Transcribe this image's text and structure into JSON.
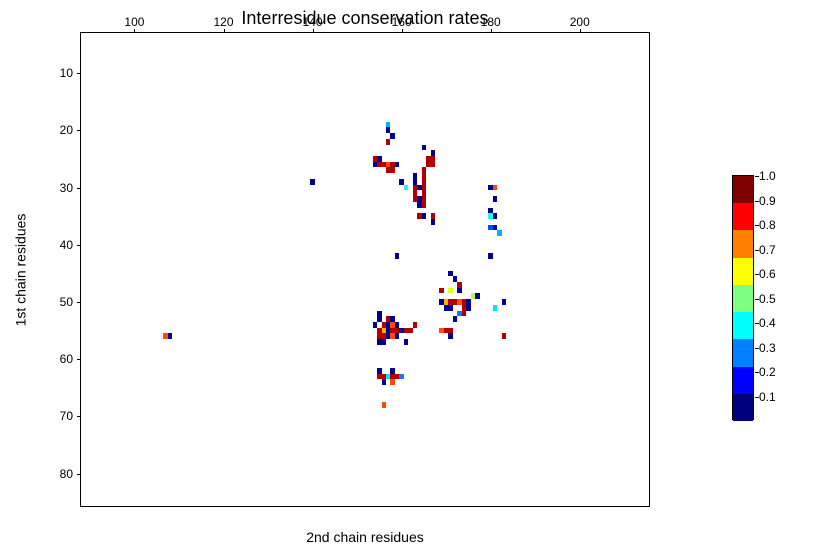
{
  "chart_data": {
    "type": "heatmap",
    "title": "Interresidue conservation rates",
    "xlabel": "2nd chain residues",
    "ylabel": "1st chain residues",
    "xlim": [
      88,
      216
    ],
    "ylim": [
      86,
      3
    ],
    "x_ticks": [
      100,
      120,
      140,
      160,
      180,
      200
    ],
    "y_ticks": [
      10,
      20,
      30,
      40,
      50,
      60,
      70,
      80
    ],
    "colorbar": {
      "ticks": [
        0.1,
        0.2,
        0.3,
        0.4,
        0.5,
        0.6,
        0.7,
        0.8,
        0.9,
        1.0
      ],
      "colors": [
        "#00007f",
        "#0000ff",
        "#007fff",
        "#00ffff",
        "#7fff7f",
        "#ffff00",
        "#ff7f00",
        "#ff0000",
        "#7f0000"
      ]
    },
    "points": [
      {
        "x": 157,
        "y": 19,
        "v": 0.3
      },
      {
        "x": 157,
        "y": 20,
        "v": 0.02
      },
      {
        "x": 158,
        "y": 21,
        "v": 0.02
      },
      {
        "x": 157,
        "y": 22,
        "v": 0.95
      },
      {
        "x": 165,
        "y": 23,
        "v": 0.02
      },
      {
        "x": 167,
        "y": 24,
        "v": 0.02
      },
      {
        "x": 154,
        "y": 25,
        "v": 0.95
      },
      {
        "x": 155,
        "y": 25,
        "v": 0.02
      },
      {
        "x": 166,
        "y": 25,
        "v": 0.95
      },
      {
        "x": 167,
        "y": 25,
        "v": 0.95
      },
      {
        "x": 154,
        "y": 26,
        "v": 0.02
      },
      {
        "x": 155,
        "y": 26,
        "v": 0.95
      },
      {
        "x": 156,
        "y": 26,
        "v": 0.95
      },
      {
        "x": 157,
        "y": 26,
        "v": 0.8
      },
      {
        "x": 158,
        "y": 26,
        "v": 0.95
      },
      {
        "x": 159,
        "y": 26,
        "v": 0.02
      },
      {
        "x": 166,
        "y": 26,
        "v": 0.95
      },
      {
        "x": 167,
        "y": 26,
        "v": 0.95
      },
      {
        "x": 157,
        "y": 27,
        "v": 0.95
      },
      {
        "x": 158,
        "y": 27,
        "v": 0.95
      },
      {
        "x": 165,
        "y": 27,
        "v": 0.95
      },
      {
        "x": 163,
        "y": 28,
        "v": 0.02
      },
      {
        "x": 165,
        "y": 28,
        "v": 0.95
      },
      {
        "x": 160,
        "y": 29,
        "v": 0.02
      },
      {
        "x": 163,
        "y": 29,
        "v": 0.02
      },
      {
        "x": 165,
        "y": 29,
        "v": 0.95
      },
      {
        "x": 140,
        "y": 29,
        "v": 0.02
      },
      {
        "x": 161,
        "y": 30,
        "v": 0.4
      },
      {
        "x": 163,
        "y": 30,
        "v": 0.95
      },
      {
        "x": 164,
        "y": 30,
        "v": 0.02
      },
      {
        "x": 165,
        "y": 30,
        "v": 0.95
      },
      {
        "x": 180,
        "y": 30,
        "v": 0.02
      },
      {
        "x": 181,
        "y": 30,
        "v": 0.8
      },
      {
        "x": 163,
        "y": 31,
        "v": 0.95
      },
      {
        "x": 165,
        "y": 31,
        "v": 0.95
      },
      {
        "x": 163,
        "y": 32,
        "v": 0.95
      },
      {
        "x": 164,
        "y": 32,
        "v": 0.02
      },
      {
        "x": 165,
        "y": 32,
        "v": 0.95
      },
      {
        "x": 181,
        "y": 32,
        "v": 0.02
      },
      {
        "x": 164,
        "y": 33,
        "v": 0.02
      },
      {
        "x": 165,
        "y": 33,
        "v": 0.95
      },
      {
        "x": 180,
        "y": 34,
        "v": 0.02
      },
      {
        "x": 164,
        "y": 35,
        "v": 0.95
      },
      {
        "x": 165,
        "y": 35,
        "v": 0.02
      },
      {
        "x": 167,
        "y": 35,
        "v": 0.95
      },
      {
        "x": 180,
        "y": 35,
        "v": 0.4
      },
      {
        "x": 181,
        "y": 35,
        "v": 0.02
      },
      {
        "x": 167,
        "y": 36,
        "v": 0.02
      },
      {
        "x": 180,
        "y": 37,
        "v": 0.2
      },
      {
        "x": 181,
        "y": 37,
        "v": 0.02
      },
      {
        "x": 182,
        "y": 38,
        "v": 0.3
      },
      {
        "x": 159,
        "y": 42,
        "v": 0.02
      },
      {
        "x": 180,
        "y": 42,
        "v": 0.02
      },
      {
        "x": 171,
        "y": 45,
        "v": 0.02
      },
      {
        "x": 172,
        "y": 46,
        "v": 0.02
      },
      {
        "x": 173,
        "y": 47,
        "v": 0.95
      },
      {
        "x": 173,
        "y": 48,
        "v": 0.02
      },
      {
        "x": 169,
        "y": 48,
        "v": 0.95
      },
      {
        "x": 171,
        "y": 48,
        "v": 0.6
      },
      {
        "x": 176,
        "y": 49,
        "v": 0.55
      },
      {
        "x": 177,
        "y": 49,
        "v": 0.02
      },
      {
        "x": 169,
        "y": 50,
        "v": 0.02
      },
      {
        "x": 170,
        "y": 50,
        "v": 0.7
      },
      {
        "x": 171,
        "y": 50,
        "v": 0.95
      },
      {
        "x": 172,
        "y": 50,
        "v": 0.95
      },
      {
        "x": 173,
        "y": 50,
        "v": 0.8
      },
      {
        "x": 174,
        "y": 50,
        "v": 0.95
      },
      {
        "x": 175,
        "y": 50,
        "v": 0.02
      },
      {
        "x": 183,
        "y": 50,
        "v": 0.02
      },
      {
        "x": 170,
        "y": 51,
        "v": 0.02
      },
      {
        "x": 171,
        "y": 51,
        "v": 0.02
      },
      {
        "x": 174,
        "y": 51,
        "v": 0.95
      },
      {
        "x": 175,
        "y": 51,
        "v": 0.02
      },
      {
        "x": 181,
        "y": 51,
        "v": 0.35
      },
      {
        "x": 155,
        "y": 52,
        "v": 0.02
      },
      {
        "x": 173,
        "y": 52,
        "v": 0.25
      },
      {
        "x": 174,
        "y": 52,
        "v": 0.95
      },
      {
        "x": 155,
        "y": 53,
        "v": 0.02
      },
      {
        "x": 157,
        "y": 53,
        "v": 0.95
      },
      {
        "x": 158,
        "y": 53,
        "v": 0.02
      },
      {
        "x": 172,
        "y": 53,
        "v": 0.02
      },
      {
        "x": 154,
        "y": 54,
        "v": 0.02
      },
      {
        "x": 156,
        "y": 54,
        "v": 0.95
      },
      {
        "x": 157,
        "y": 54,
        "v": 0.02
      },
      {
        "x": 158,
        "y": 54,
        "v": 0.8
      },
      {
        "x": 159,
        "y": 54,
        "v": 0.02
      },
      {
        "x": 163,
        "y": 54,
        "v": 0.95
      },
      {
        "x": 155,
        "y": 55,
        "v": 0.95
      },
      {
        "x": 156,
        "y": 55,
        "v": 0.7
      },
      {
        "x": 157,
        "y": 55,
        "v": 0.02
      },
      {
        "x": 158,
        "y": 55,
        "v": 0.95
      },
      {
        "x": 159,
        "y": 55,
        "v": 0.95
      },
      {
        "x": 160,
        "y": 55,
        "v": 0.02
      },
      {
        "x": 161,
        "y": 55,
        "v": 0.95
      },
      {
        "x": 162,
        "y": 55,
        "v": 0.95
      },
      {
        "x": 169,
        "y": 55,
        "v": 0.8
      },
      {
        "x": 170,
        "y": 55,
        "v": 0.95
      },
      {
        "x": 171,
        "y": 55,
        "v": 0.95
      },
      {
        "x": 107,
        "y": 56,
        "v": 0.8
      },
      {
        "x": 108,
        "y": 56,
        "v": 0.02
      },
      {
        "x": 155,
        "y": 56,
        "v": 0.95
      },
      {
        "x": 156,
        "y": 56,
        "v": 0.95
      },
      {
        "x": 157,
        "y": 56,
        "v": 0.02
      },
      {
        "x": 158,
        "y": 56,
        "v": 0.8
      },
      {
        "x": 159,
        "y": 56,
        "v": 0.02
      },
      {
        "x": 171,
        "y": 56,
        "v": 0.02
      },
      {
        "x": 183,
        "y": 56,
        "v": 0.95
      },
      {
        "x": 155,
        "y": 57,
        "v": 0.02
      },
      {
        "x": 156,
        "y": 57,
        "v": 0.02
      },
      {
        "x": 161,
        "y": 57,
        "v": 0.02
      },
      {
        "x": 155,
        "y": 62,
        "v": 0.02
      },
      {
        "x": 158,
        "y": 62,
        "v": 0.02
      },
      {
        "x": 155,
        "y": 63,
        "v": 0.95
      },
      {
        "x": 156,
        "y": 63,
        "v": 0.95
      },
      {
        "x": 157,
        "y": 63,
        "v": 0.35
      },
      {
        "x": 158,
        "y": 63,
        "v": 0.95
      },
      {
        "x": 159,
        "y": 63,
        "v": 0.95
      },
      {
        "x": 160,
        "y": 63,
        "v": 0.25
      },
      {
        "x": 156,
        "y": 64,
        "v": 0.02
      },
      {
        "x": 158,
        "y": 64,
        "v": 0.8
      },
      {
        "x": 156,
        "y": 68,
        "v": 0.8
      }
    ]
  }
}
